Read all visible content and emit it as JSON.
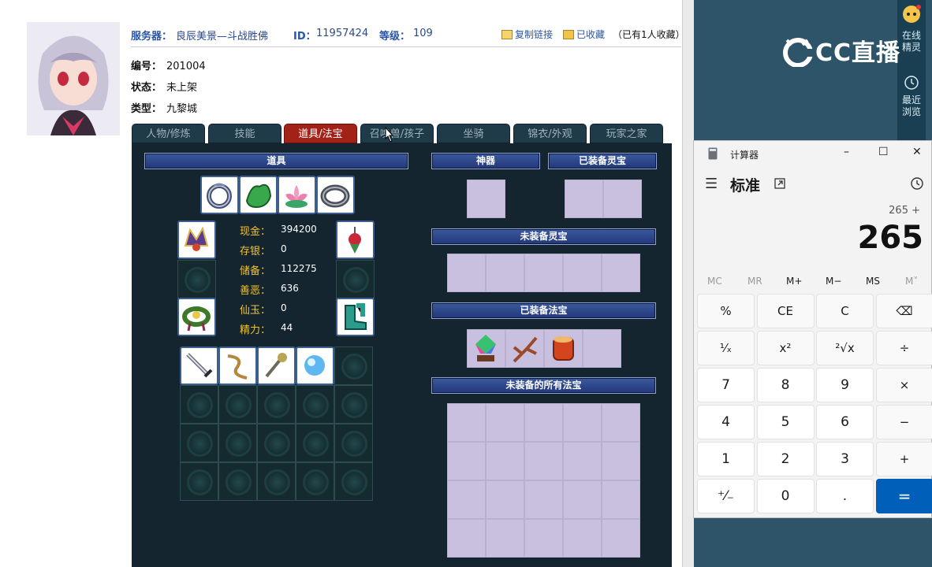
{
  "game": {
    "server_label": "服务器：",
    "server_value": "良辰美景—斗战胜佛",
    "id_label": "ID：",
    "id_value": "11957424",
    "level_label": "等级：",
    "level_value": "109",
    "copy_link": "复制链接",
    "favorited": "已收藏",
    "fav_count": "（已有1人收藏）",
    "serial_label": "编号：",
    "serial_value": "201004",
    "status_label": "状态：",
    "status_value": "未上架",
    "type_label": "类型：",
    "type_value": "九黎城",
    "tabs": [
      {
        "label": "人物/修炼"
      },
      {
        "label": "技能"
      },
      {
        "label": "道具/法宝"
      },
      {
        "label": "召唤兽/孩子"
      },
      {
        "label": "坐骑"
      },
      {
        "label": "锦衣/外观"
      },
      {
        "label": "玩家之家"
      }
    ],
    "active_tab": "道具/法宝",
    "headers": {
      "items": "道具",
      "artifact": "神器",
      "equipped_spirit": "已装备灵宝",
      "unequipped_spirit": "未装备灵宝",
      "equipped_fabao": "已装备法宝",
      "all_unequipped_fabao": "未装备的所有法宝"
    },
    "stats": [
      {
        "label": "现金：",
        "value": "394200"
      },
      {
        "label": "存银：",
        "value": "0"
      },
      {
        "label": "储备：",
        "value": "112275"
      },
      {
        "label": "善恶：",
        "value": "636"
      },
      {
        "label": "仙玉：",
        "value": "0"
      },
      {
        "label": "精力：",
        "value": "44"
      }
    ]
  },
  "side": {
    "online_helper": "在线精灵",
    "recent_browse": "最近浏览",
    "logo_text": "CC直播"
  },
  "calculator": {
    "title": "计算器",
    "mode": "标准",
    "expression": "265 +",
    "display": "265",
    "memory": [
      "MC",
      "MR",
      "M+",
      "M−",
      "MS",
      "M˅"
    ],
    "keys": [
      [
        "%",
        "CE",
        "C",
        "⌫"
      ],
      [
        "¹⁄ₓ",
        "x²",
        "²√x",
        "÷"
      ],
      [
        "7",
        "8",
        "9",
        "×"
      ],
      [
        "4",
        "5",
        "6",
        "−"
      ],
      [
        "1",
        "2",
        "3",
        "+"
      ],
      [
        "⁺⁄₋",
        "0",
        ".",
        "="
      ]
    ],
    "accent": "#005fb8"
  }
}
